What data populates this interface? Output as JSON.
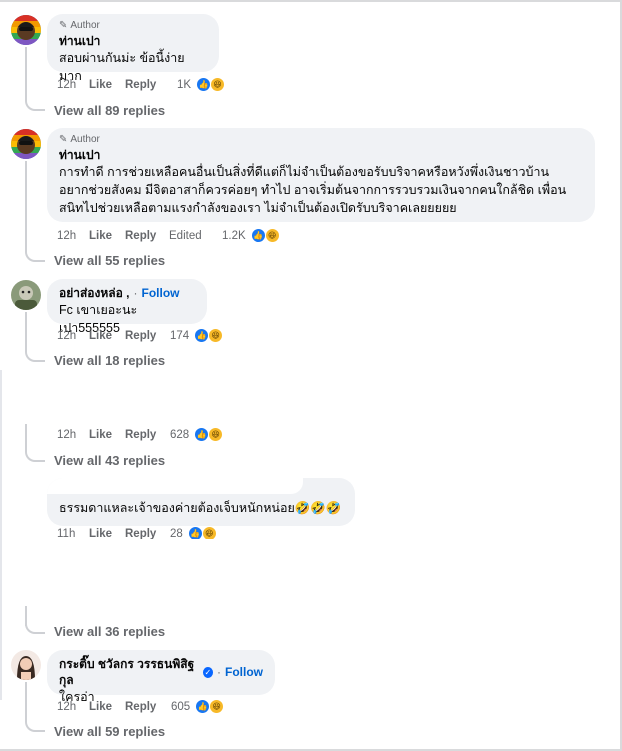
{
  "comments": [
    {
      "author_badge": "Author",
      "name": "ท่านเปา",
      "text": "สอบผ่านกันม่ะ ข้อนี้ง่ายมาก",
      "time": "12h",
      "like": "Like",
      "reply": "Reply",
      "reactions": "1K",
      "view_replies": "View all 89 replies"
    },
    {
      "author_badge": "Author",
      "name": "ท่านเปา",
      "text_lines": [
        "การทำดี การช่วยเหลือคนอื่นเป็นสิ่งที่ดีแต่ก็ไม่จำเป็นต้องขอรับบริจาคหรือหวังพึ่งเงินชาวบ้าน",
        "อยากช่วยสังคม มีจิตอาสาก็ควรค่อยๆ ทำไป อาจเริ่มต้นจากการรวบรวมเงินจากคนใกล้ชิด เพื่อน",
        "สนิทไปช่วยเหลือตามแรงกำลังของเรา ไม่จำเป็นต้องเปิดรับบริจาคเลยยยยย"
      ],
      "time": "12h",
      "like": "Like",
      "reply": "Reply",
      "edited": "Edited",
      "reactions": "1.2K",
      "view_replies": "View all 55 replies"
    },
    {
      "name": "อย่าส่องหล่อ ,",
      "follow": "Follow",
      "text": "Fc เขาเยอะนะเปา555555",
      "time": "12h",
      "like": "Like",
      "reply": "Reply",
      "reactions": "174",
      "view_replies": "View all 18 replies"
    },
    {
      "time": "12h",
      "like": "Like",
      "reply": "Reply",
      "reactions": "628",
      "view_replies": "View all 43 replies"
    },
    {
      "text": "ธรรมดาแหละเจ้าของค่ายต้องเจ็บหนักหน่อย🤣🤣🤣",
      "time": "11h",
      "like": "Like",
      "reply": "Reply",
      "reactions": "28"
    },
    {
      "view_replies": "View all 36 replies"
    },
    {
      "name": "กระติ๊บ ชวัลกร วรรธนพิสิฐกุล",
      "follow": "Follow",
      "text": "ใครอ่า",
      "time": "12h",
      "like": "Like",
      "reply": "Reply",
      "reactions": "605",
      "view_replies": "View all 59 replies"
    }
  ],
  "icons": {
    "pen": "pen-icon",
    "like_reaction": "like-reaction-icon",
    "haha_reaction": "haha-reaction-icon",
    "verified": "verified-badge-icon"
  },
  "colors": {
    "bubble": "#f0f2f5",
    "meta": "#65676b",
    "link": "#0064d1",
    "like": "#1877f2",
    "haha": "#f7b928"
  }
}
